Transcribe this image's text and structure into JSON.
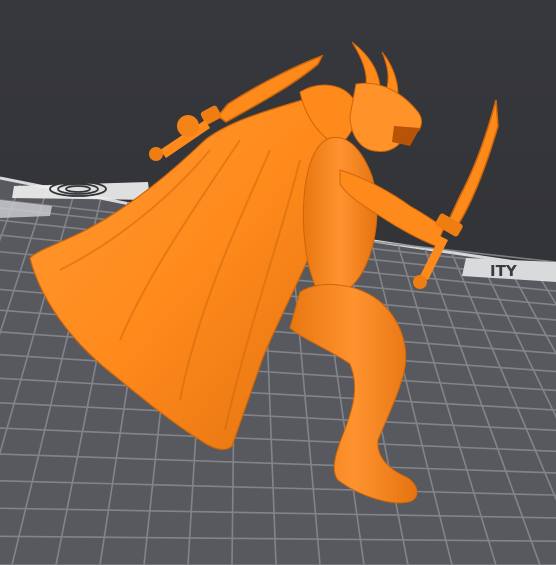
{
  "app": {
    "title": ""
  },
  "viewport": {
    "background_color": "#333438",
    "bed_color": "#5a5b5f",
    "grid_line_color": "#8a8b8f",
    "bed_edge_color": "#d7d8da",
    "model_color": "#ff8a1c",
    "model_shadow_color": "#d06608",
    "model_highlight_color": "#ffab55"
  },
  "bed": {
    "logo_icon": "swirl-logo-icon",
    "label_right": "ITY"
  },
  "model": {
    "name": ""
  }
}
